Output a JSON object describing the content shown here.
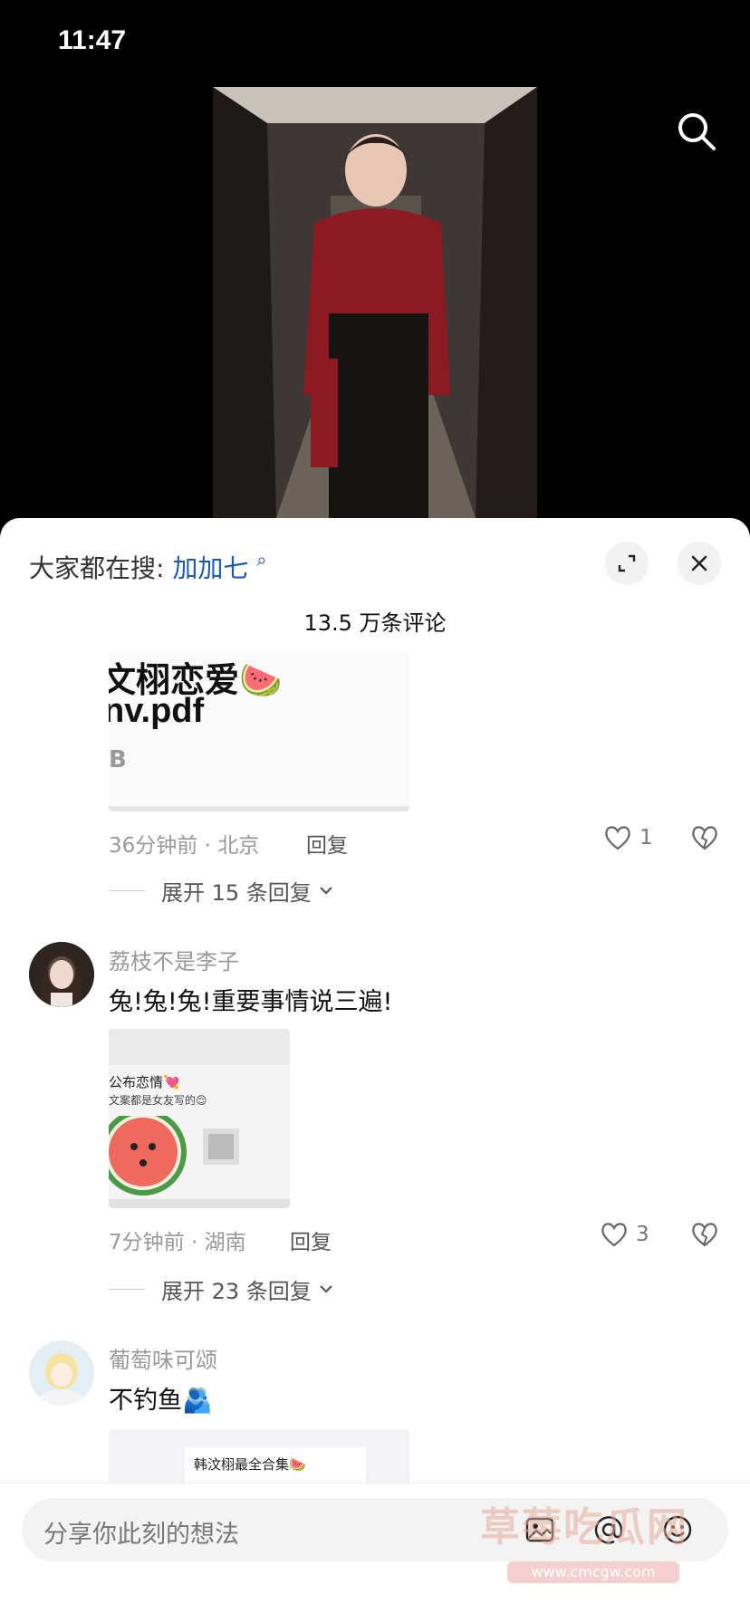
{
  "status_bar": {
    "time": "11:47"
  },
  "comments_sheet": {
    "hot_search_label": "大家都在搜:",
    "hot_search_keyword": "加加七",
    "comment_count": "13.5 万条评论"
  },
  "comments": [
    {
      "attachment_text_1": "文栩恋爱🍉",
      "attachment_text_2": "nv.pdf",
      "attachment_text_3": "B",
      "meta": "36分钟前 · 北京",
      "reply_label": "回复",
      "likes": "1",
      "expand_label": "展开 15 条回复"
    },
    {
      "username": "荔枝不是李子",
      "text": "兔!兔!兔!重要事情说三遍!",
      "attachment_text_1": "公布恋情💘",
      "attachment_text_2": "文案都是女友写的😌",
      "meta": "7分钟前 · 湖南",
      "reply_label": "回复",
      "likes": "3",
      "expand_label": "展开 23 条回复"
    },
    {
      "username": "葡萄味可颂",
      "text": "不钓鱼🫂",
      "attachment_text_1": "韩汶栩最全合集🍉"
    }
  ],
  "input_bar": {
    "placeholder": "分享你此刻的想法",
    "watermark": "草莓吃瓜网",
    "watermark_url": "www.cmcgw.com"
  },
  "icons": [
    "search-icon",
    "expand-icon",
    "close-icon",
    "heart-icon",
    "broken-heart-icon",
    "chevron-down-icon",
    "image-icon",
    "at-icon",
    "emoji-icon"
  ]
}
